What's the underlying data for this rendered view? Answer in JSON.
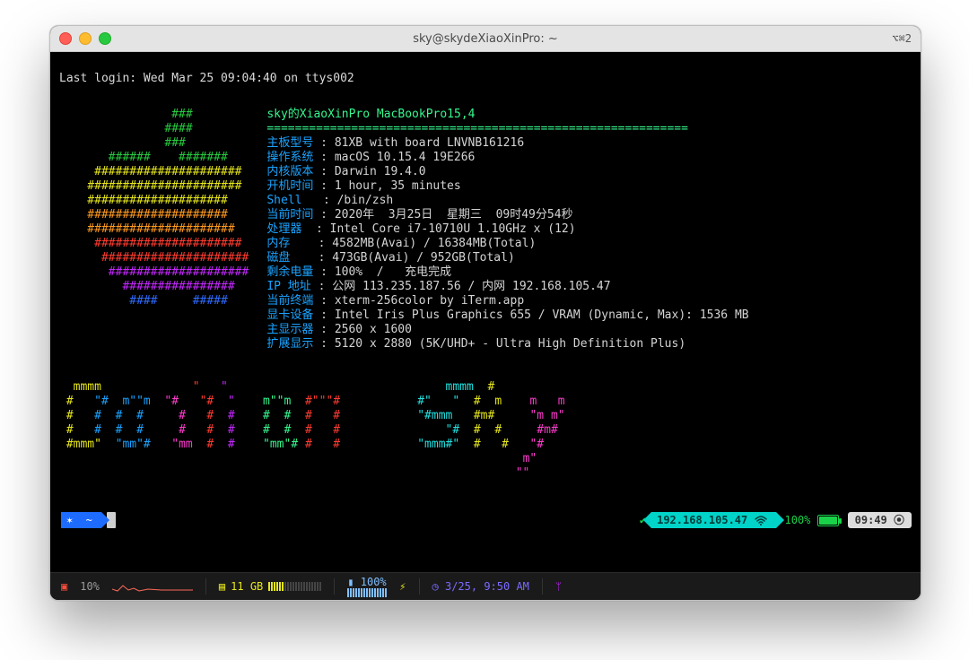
{
  "titlebar": {
    "title": "sky@skydeXiaoXinPro: ~",
    "right": "⌥⌘2"
  },
  "term": {
    "last_login": "Last login: Wed Mar 25 09:04:40 on ttys002",
    "header": "sky的XiaoXinPro MacBookPro15,4",
    "rule": "============================================================",
    "info": [
      {
        "k": "主板型号",
        "v": "81XB with board LNVNB161216"
      },
      {
        "k": "操作系统",
        "v": "macOS 10.15.4 19E266"
      },
      {
        "k": "内核版本",
        "v": "Darwin 19.4.0"
      },
      {
        "k": "开机时间",
        "v": "1 hour, 35 minutes"
      },
      {
        "k": "Shell  ",
        "v": "/bin/zsh"
      },
      {
        "k": "当前时间",
        "v": "2020年  3月25日  星期三  09时49分54秒"
      },
      {
        "k": "处理器 ",
        "v": "Intel Core i7-10710U 1.10GHz x (12)"
      },
      {
        "k": "内存   ",
        "v": "4582MB(Avai) / 16384MB(Total)"
      },
      {
        "k": "磁盘   ",
        "v": "473GB(Avai) / 952GB(Total)"
      },
      {
        "k": "剩余电量",
        "v": "100%  /   充电完成"
      },
      {
        "k": "IP 地址",
        "v": "公网 113.235.187.56 / 内网 192.168.105.47"
      },
      {
        "k": "当前终端",
        "v": "xterm-256color by iTerm.app"
      },
      {
        "k": "显卡设备",
        "v": "Intel Iris Plus Graphics 655 / VRAM (Dynamic, Max): 1536 MB"
      },
      {
        "k": "主显示器",
        "v": "2560 x 1600"
      },
      {
        "k": "扩展显示",
        "v": "5120 x 2880 (5K/UHD+ - Ultra High Definition Plus)"
      }
    ]
  },
  "statusline": {
    "home": "✶  ~",
    "ip": "192.168.105.47",
    "battery": "100%",
    "clock": "09:49 ⦿"
  },
  "bottombar": {
    "cpu": "10%",
    "ram": "11 GB",
    "battery": "100%",
    "datetime": "3/25, 9:50 AM"
  }
}
